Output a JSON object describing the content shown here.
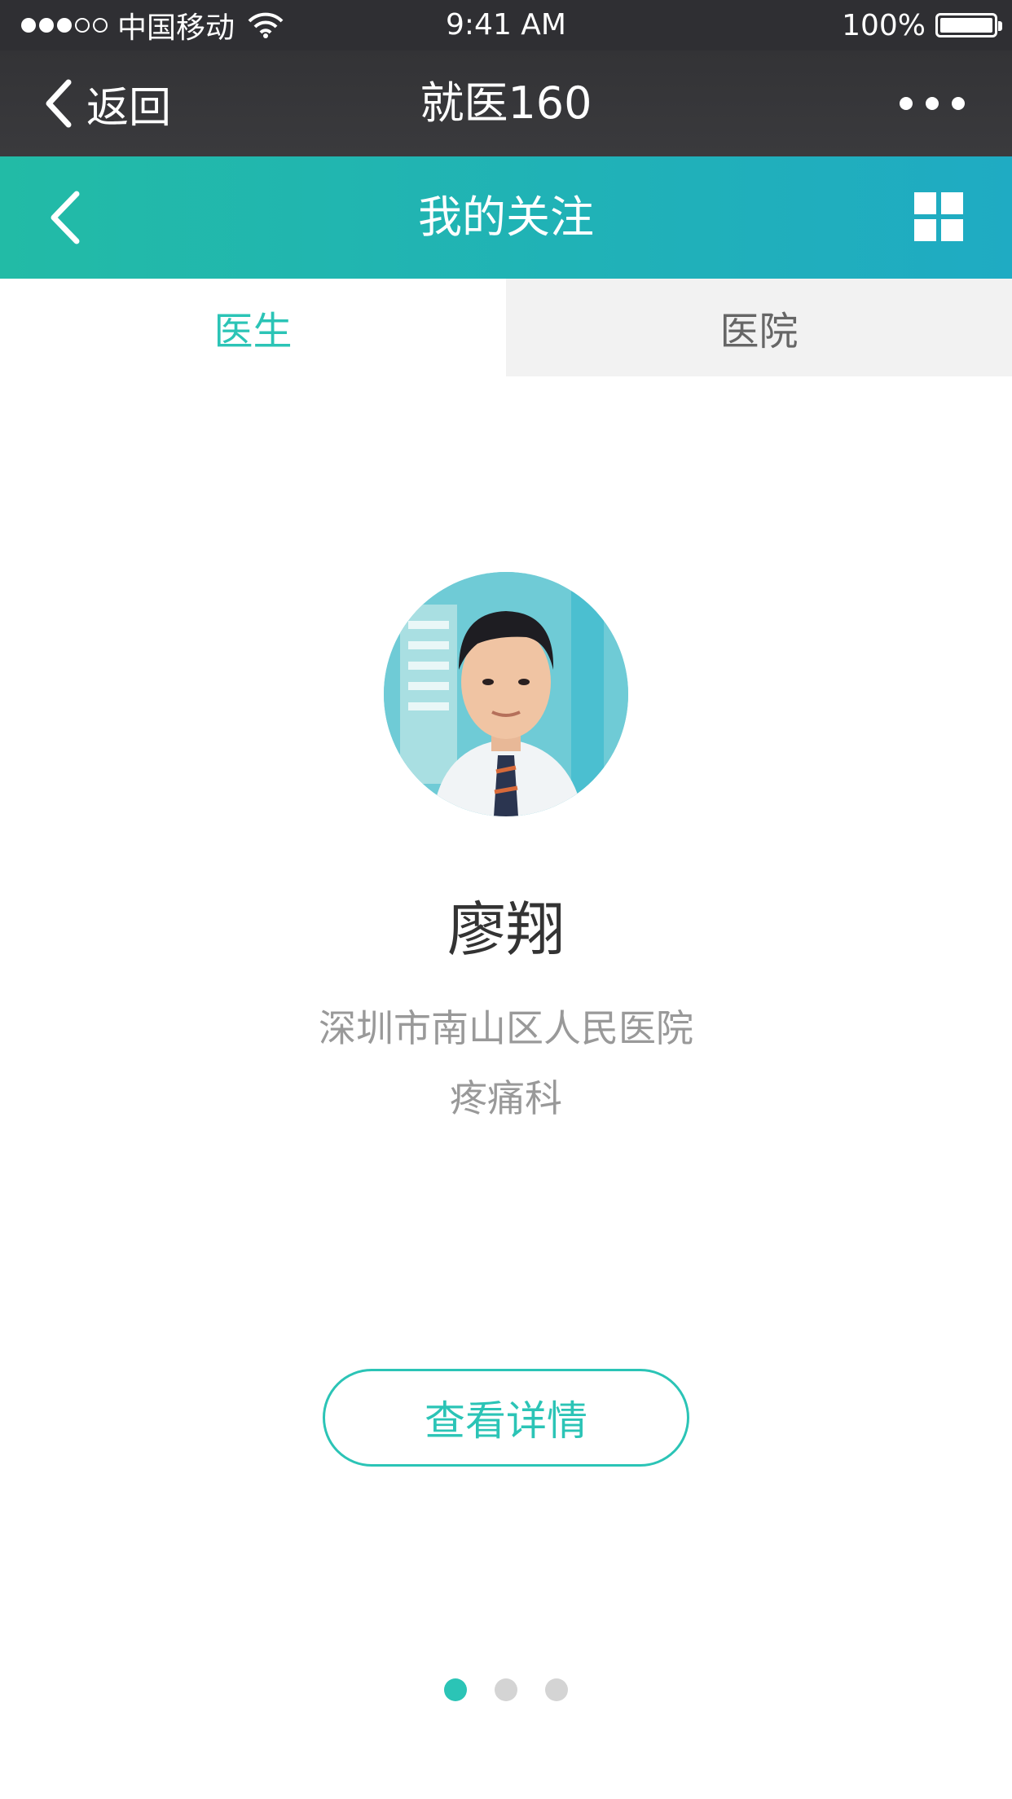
{
  "status_bar": {
    "carrier": "中国移动",
    "time": "9:41 AM",
    "battery": "100%"
  },
  "wechat_nav": {
    "back_label": "返回",
    "title": "就医160"
  },
  "header": {
    "title": "我的关注"
  },
  "tabs": [
    {
      "label": "医生",
      "active": true
    },
    {
      "label": "医院",
      "active": false
    }
  ],
  "doctor": {
    "name": "廖翔",
    "hospital": "深圳市南山区人民医院",
    "department": "疼痛科"
  },
  "actions": {
    "detail_label": "查看详情"
  },
  "pager": {
    "count": 3,
    "active_index": 0
  },
  "colors": {
    "accent": "#2bc4b6",
    "header_gradient_start": "#22bba6",
    "header_gradient_end": "#1fabc3",
    "nav_bg": "#333336"
  }
}
